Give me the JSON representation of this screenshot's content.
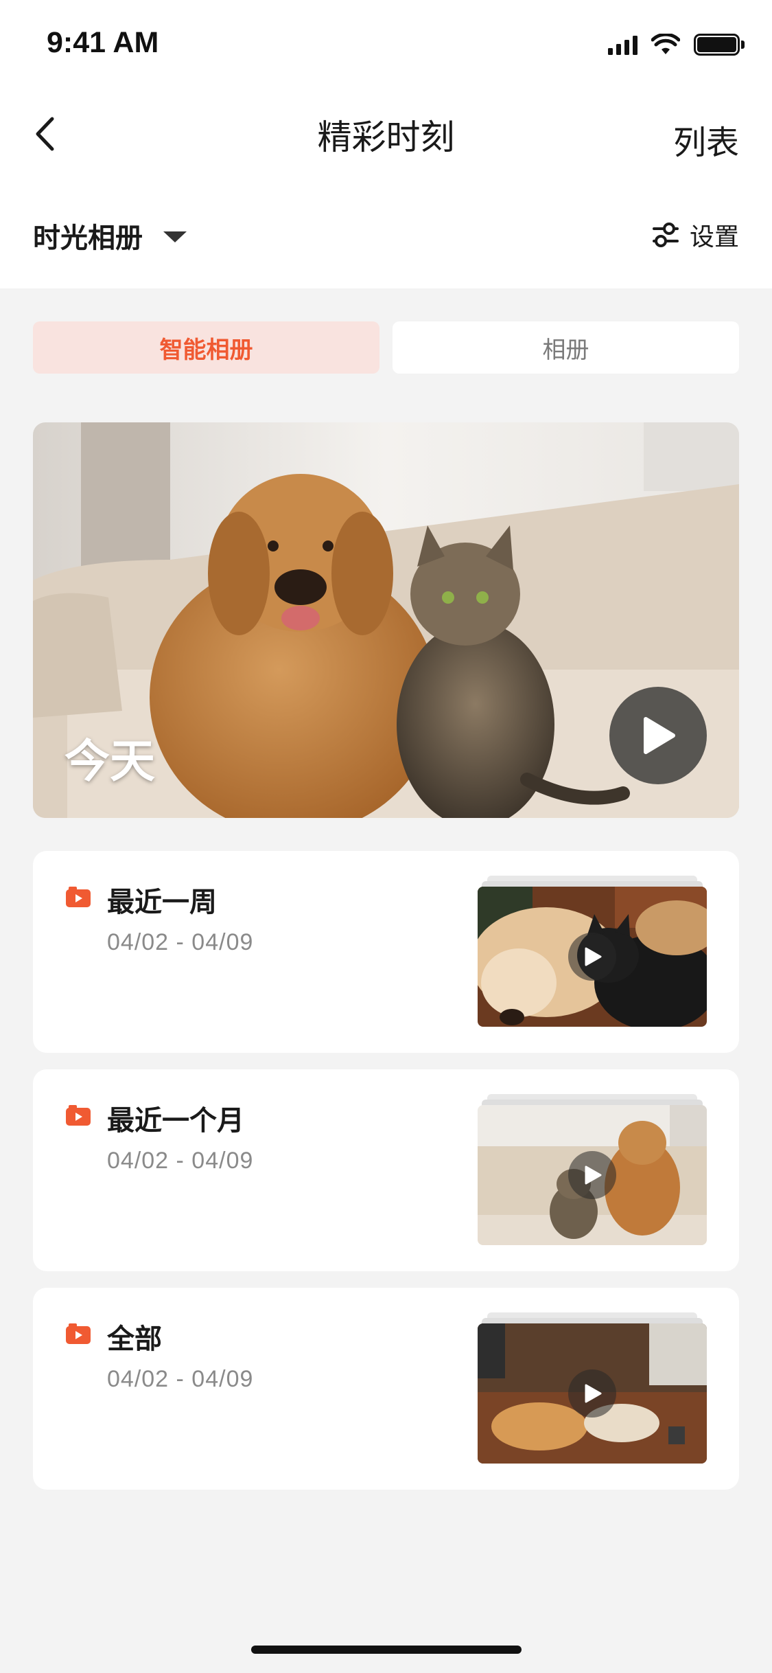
{
  "status_bar": {
    "time": "9:41 AM"
  },
  "nav": {
    "title": "精彩时刻",
    "right_action": "列表"
  },
  "album_selector": {
    "label": "时光相册",
    "settings_label": "设置"
  },
  "tabs": [
    {
      "label": "智能相册",
      "active": true
    },
    {
      "label": "相册",
      "active": false
    }
  ],
  "hero": {
    "label": "今天"
  },
  "albums": [
    {
      "title": "最近一周",
      "date_range": "04/02 - 04/09"
    },
    {
      "title": "最近一个月",
      "date_range": "04/02 - 04/09"
    },
    {
      "title": "全部",
      "date_range": "04/02 - 04/09"
    }
  ],
  "colors": {
    "accent": "#f05a32",
    "tab_active_bg": "#f9e3df",
    "page_bg": "#f3f3f3"
  }
}
